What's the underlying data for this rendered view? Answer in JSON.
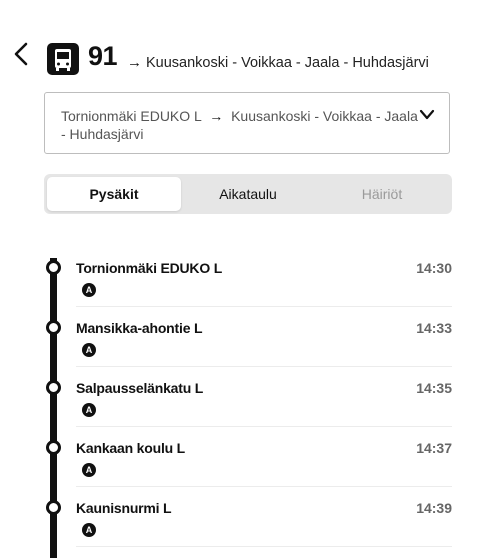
{
  "header": {
    "back_icon": "chevron-left-icon",
    "vehicle_icon": "bus-icon",
    "route_number": "91",
    "arrow": "→",
    "destination": "Kuusankoski - Voikkaa - Jaala - Huhdasjärvi"
  },
  "direction": {
    "origin": "Tornionmäki EDUKO L",
    "arrow": "→",
    "destination": "Kuusankoski - Voikkaa - Jaala - Huhdasjärvi",
    "chevron_icon": "chevron-down-icon"
  },
  "tabs": [
    {
      "label": "Pysäkit",
      "selected": true
    },
    {
      "label": "Aikataulu",
      "selected": false
    },
    {
      "label": "Häiriöt",
      "selected": false,
      "disabled": true
    }
  ],
  "stops": [
    {
      "name": "Tornionmäki EDUKO L",
      "time": "14:30",
      "platform": "A"
    },
    {
      "name": "Mansikka-ahontie L",
      "time": "14:33",
      "platform": "A"
    },
    {
      "name": "Salpausselänkatu L",
      "time": "14:35",
      "platform": "A"
    },
    {
      "name": "Kankaan koulu L",
      "time": "14:37",
      "platform": "A"
    },
    {
      "name": "Kaunisnurmi L",
      "time": "14:39",
      "platform": "A"
    }
  ],
  "colors": {
    "route_line": "#111111",
    "tab_bg": "#e6e6e6",
    "disabled_tab": "#9a9a9a",
    "time_text": "#666666"
  }
}
